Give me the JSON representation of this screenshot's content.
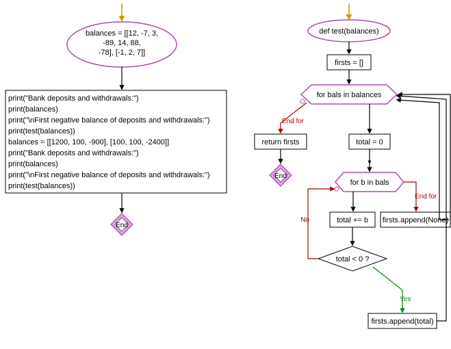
{
  "left": {
    "start_node": "balances = [[12, -7, 3,\n-89, 14, 88,\n-78], [-1, 2, 7]]",
    "code_block": "print(\"Bank deposits and withdrawals:\")\nprint(balances)\nprint(\"\\nFirst negative balance of deposits and withdrawals:\")\nprint(test(balances))\nbalances = [[1200, 100, -900], [100, 100, -2400]]\nprint(\"Bank deposits and withdrawals:\")\nprint(balances)\nprint(\"\\nFirst negative balance of deposits and withdrawals:\")\nprint(test(balances))",
    "end_label": "End"
  },
  "right": {
    "func_def": "def test(balances)",
    "init_firsts": "firsts = []",
    "outer_loop": "for bals in balances",
    "outer_end": "End for",
    "return_stmt": "return firsts",
    "end_label1": "End",
    "total_init": "total = 0",
    "inner_loop": "for b in bals",
    "inner_end": "End for",
    "accum": "total += b",
    "cond": "total < 0 ?",
    "branch_no": "No",
    "branch_yes": "Yes",
    "append_none": "firsts.append(None)",
    "append_total": "firsts.append(total)"
  },
  "colors": {
    "arrow_default": "#000000",
    "arrow_entry": "#cc9900",
    "arrow_green": "#008800",
    "arrow_red": "#aa0000",
    "ellipse_stroke": "#a64da6",
    "hex_stroke": "#a64da6",
    "end_fill": "#d9a6d9",
    "end_inner": "#ffffff"
  }
}
